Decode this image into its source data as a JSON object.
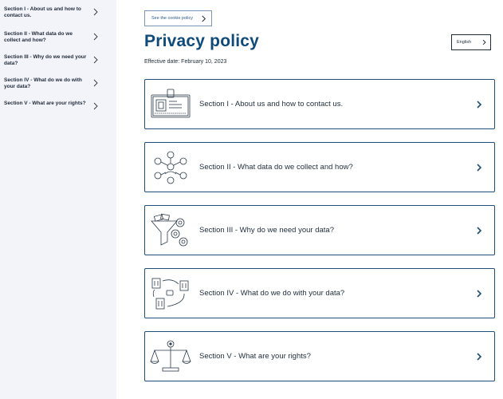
{
  "sidebar": {
    "items": [
      {
        "label": "Section I - About us and how to contact us."
      },
      {
        "label": "Section II - What data do we collect and how?"
      },
      {
        "label": "Section III - Why do we need your data?"
      },
      {
        "label": "Section IV - What do we do with your data?"
      },
      {
        "label": "Section V - What are your rights?"
      }
    ]
  },
  "header": {
    "cookie_button": "See the cookie policy",
    "title": "Privacy policy",
    "language": "English",
    "effective_date": "Effective date: February 10, 2023"
  },
  "sections": [
    {
      "label": "Section I - About us and how to contact us.",
      "icon": "id-card-icon"
    },
    {
      "label": "Section II - What data do we collect and how?",
      "icon": "data-network-icon"
    },
    {
      "label": "Section III - Why do we need your data?",
      "icon": "funnel-gears-icon"
    },
    {
      "label": "Section IV - What do we do with your data?",
      "icon": "buildings-cycle-icon"
    },
    {
      "label": "Section V - What are your rights?",
      "icon": "scales-icon"
    }
  ],
  "colors": {
    "brand": "#0e4a7a",
    "border": "#1f4e79",
    "sidebar_bg": "#f3f4fa"
  }
}
